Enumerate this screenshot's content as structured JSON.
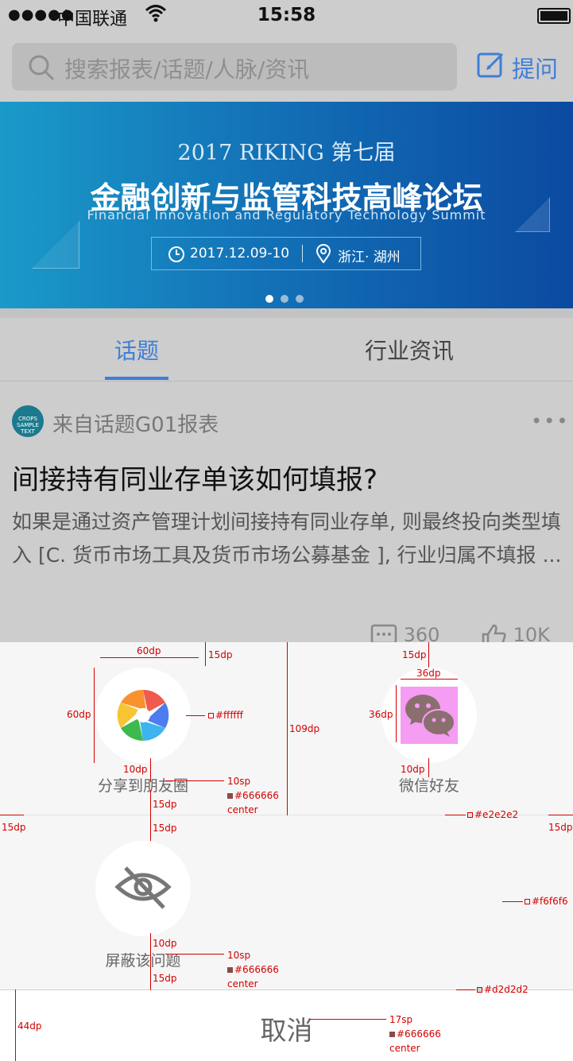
{
  "status_bar": {
    "signal": "●●●●●",
    "carrier": "中国联通",
    "wifi_icon": "wifi-icon",
    "time": "15:58",
    "battery_icon": "battery-icon"
  },
  "search": {
    "placeholder": "搜索报表/话题/人脉/资讯",
    "ask_label": "提问"
  },
  "banner": {
    "title_en": "2017 RIKING 第七届",
    "title_cn": "金融创新与监管科技高峰论坛",
    "subtitle": "Financial Innovation and Regulatory Technology Summit",
    "date": "2017.12.09-10",
    "place": "浙江· 湖州",
    "page_count": 3,
    "active_page": 1
  },
  "tabs": [
    {
      "label": "话题",
      "active": true
    },
    {
      "label": "行业资讯",
      "active": false
    }
  ],
  "post": {
    "avatar_text": "CROPS SAMPLE TEXT",
    "from": "来自话题G01报表",
    "more": "•••",
    "question": "间接持有同业存单该如何填报?",
    "body": "如果是通过资产管理计划间接持有同业存单, 则最终投向类型填入 [C. 货币市场工具及货币市场公募基金 ], 行业归属不填报 ...",
    "comments": "360",
    "likes": "10K"
  },
  "share": {
    "moments_label": "分享到朋友圈",
    "wechat_label": "微信好友",
    "block_label": "屏蔽该问题",
    "cancel_label": "取消"
  },
  "annotations": {
    "a_60dp_w": "60dp",
    "a_15dp_top": "15dp",
    "a_60dp_h": "60dp",
    "a_ffffff": "#ffffff",
    "a_109dp": "109dp",
    "a_15dp_r": "15dp",
    "a_36dp_w": "36dp",
    "a_36dp_h": "36dp",
    "a_10dp_1": "10dp",
    "a_10dp_2": "10dp",
    "a_10sp_1": "10sp",
    "a_666_1": "#666666",
    "a_center_1": "center",
    "a_15dp_3": "15dp",
    "a_15dp_4": "15dp",
    "a_15dp_left": "15dp",
    "a_15dp_right": "15dp",
    "a_e2": "#e2e2e2",
    "a_f6": "#f6f6f6",
    "a_10dp_3": "10dp",
    "a_10sp_2": "10sp",
    "a_666_2": "#666666",
    "a_center_2": "center",
    "a_15dp_5": "15dp",
    "a_d2": "#d2d2d2",
    "a_44dp": "44dp",
    "a_17sp": "17sp",
    "a_666_3": "#666666",
    "a_center_3": "center"
  },
  "colors": {
    "accent": "#3f7ed7",
    "sheet_bg": "#f6f6f6",
    "divider": "#e2e2e2",
    "cancel_border": "#d2d2d2",
    "label": "#666666",
    "annotation": "#d40000"
  }
}
